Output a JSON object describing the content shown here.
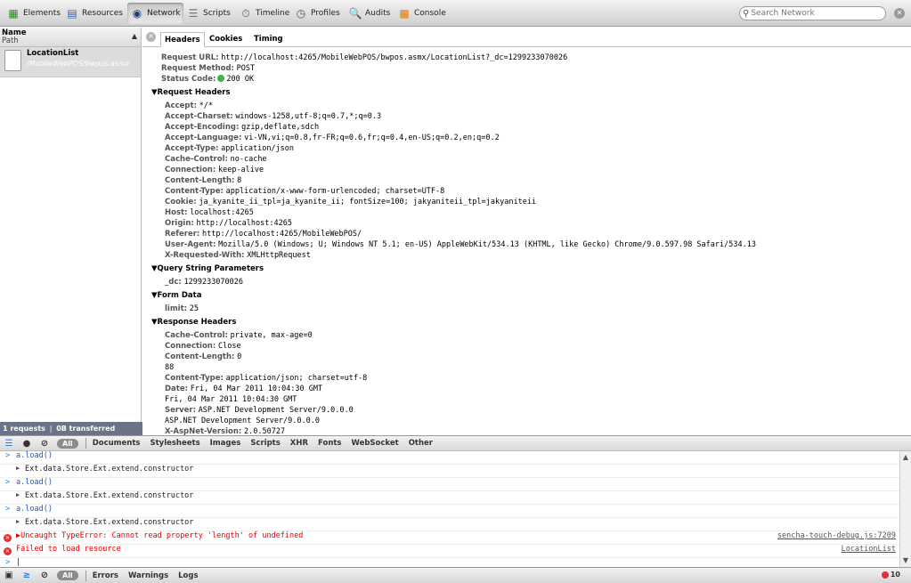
{
  "toolbar": {
    "items": [
      {
        "label": "Elements",
        "icon": "elements-icon"
      },
      {
        "label": "Resources",
        "icon": "resources-icon"
      },
      {
        "label": "Network",
        "icon": "network-icon",
        "active": true
      },
      {
        "label": "Scripts",
        "icon": "scripts-icon"
      },
      {
        "label": "Timeline",
        "icon": "timeline-icon"
      },
      {
        "label": "Profiles",
        "icon": "profiles-icon"
      },
      {
        "label": "Audits",
        "icon": "audits-icon"
      },
      {
        "label": "Console",
        "icon": "console-icon"
      }
    ],
    "search_placeholder": "Search Network"
  },
  "request_list": {
    "col_name": "Name",
    "col_path": "Path",
    "request_name": "LocationList",
    "request_path": "/MobileWebPOS/bwpos.asmx",
    "status": "1 requests  ❘  0B transferred"
  },
  "detail_tabs": [
    "Headers",
    "Cookies",
    "Timing"
  ],
  "headers": {
    "general": [
      {
        "k": "Request URL:",
        "v": "http://localhost:4265/MobileWebPOS/bwpos.asmx/LocationList?_dc=1299233070026"
      },
      {
        "k": "Request Method:",
        "v": "POST"
      },
      {
        "k": "Status Code:",
        "v": "200 OK"
      }
    ],
    "request_headers_title": "▼Request Headers",
    "request_headers": [
      {
        "k": "Accept:",
        "v": "*/*"
      },
      {
        "k": "Accept-Charset:",
        "v": "windows-1258,utf-8;q=0.7,*;q=0.3"
      },
      {
        "k": "Accept-Encoding:",
        "v": "gzip,deflate,sdch"
      },
      {
        "k": "Accept-Language:",
        "v": "vi-VN,vi;q=0.8,fr-FR;q=0.6,fr;q=0.4,en-US;q=0.2,en;q=0.2"
      },
      {
        "k": "Accept-Type:",
        "v": "application/json"
      },
      {
        "k": "Cache-Control:",
        "v": "no-cache"
      },
      {
        "k": "Connection:",
        "v": "keep-alive"
      },
      {
        "k": "Content-Length:",
        "v": "8"
      },
      {
        "k": "Content-Type:",
        "v": "application/x-www-form-urlencoded; charset=UTF-8"
      },
      {
        "k": "Cookie:",
        "v": "ja_kyanite_ii_tpl=ja_kyanite_ii; fontSize=100; jakyaniteii_tpl=jakyaniteii"
      },
      {
        "k": "Host:",
        "v": "localhost:4265"
      },
      {
        "k": "Origin:",
        "v": "http://localhost:4265"
      },
      {
        "k": "Referer:",
        "v": "http://localhost:4265/MobileWebPOS/"
      },
      {
        "k": "User-Agent:",
        "v": "Mozilla/5.0 (Windows; U; Windows NT 5.1; en-US) AppleWebKit/534.13 (KHTML, like Gecko) Chrome/9.0.597.98 Safari/534.13"
      },
      {
        "k": "X-Requested-With:",
        "v": "XMLHttpRequest"
      }
    ],
    "query_title": "▼Query String Parameters",
    "query": [
      {
        "k": "_dc:",
        "v": "1299233070026"
      }
    ],
    "form_title": "▼Form Data",
    "form": [
      {
        "k": "limit:",
        "v": "25"
      }
    ],
    "response_title": "▼Response Headers",
    "response_headers": [
      {
        "k": "Cache-Control:",
        "v": "private, max-age=0"
      },
      {
        "k": "Connection:",
        "v": "Close"
      },
      {
        "k": "Content-Length:",
        "v": "0"
      },
      {
        "k": "",
        "v": "88"
      },
      {
        "k": "Content-Type:",
        "v": "application/json; charset=utf-8"
      },
      {
        "k": "Date:",
        "v": "Fri, 04 Mar 2011 10:04:30 GMT"
      },
      {
        "k": "",
        "v": "Fri, 04 Mar 2011 10:04:30 GMT"
      },
      {
        "k": "Server:",
        "v": "ASP.NET Development Server/9.0.0.0"
      },
      {
        "k": "",
        "v": "ASP.NET Development Server/9.0.0.0"
      },
      {
        "k": "X-AspNet-Version:",
        "v": "2.0.50727"
      }
    ]
  },
  "filterbar": {
    "all": "All",
    "filters": [
      "Documents",
      "Stylesheets",
      "Images",
      "Scripts",
      "XHR",
      "Fonts",
      "WebSocket",
      "Other"
    ]
  },
  "console": {
    "lines": [
      {
        "type": "cmd",
        "text": "a.load()"
      },
      {
        "type": "result",
        "text": "Ext.data.Store.Ext.extend.constructor"
      },
      {
        "type": "cmd",
        "text": "a.load()"
      },
      {
        "type": "result",
        "text": "Ext.data.Store.Ext.extend.constructor"
      },
      {
        "type": "cmd",
        "text": "a.load()"
      },
      {
        "type": "result",
        "text": "Ext.data.Store.Ext.extend.constructor"
      },
      {
        "type": "error",
        "text": "▶Uncaught TypeError: Cannot read property 'length' of undefined",
        "link": "sencha-touch-debug.js:7209"
      },
      {
        "type": "error",
        "text": "Failed to load resource",
        "link": "LocationList"
      },
      {
        "type": "prompt",
        "text": "|"
      }
    ]
  },
  "bottombar": {
    "all": "All",
    "filters": [
      "Errors",
      "Warnings",
      "Logs"
    ],
    "error_count": "10"
  },
  "colors": {
    "status_bar": "#6b7385",
    "error": "#dd3333",
    "ok": "#39b54a"
  }
}
